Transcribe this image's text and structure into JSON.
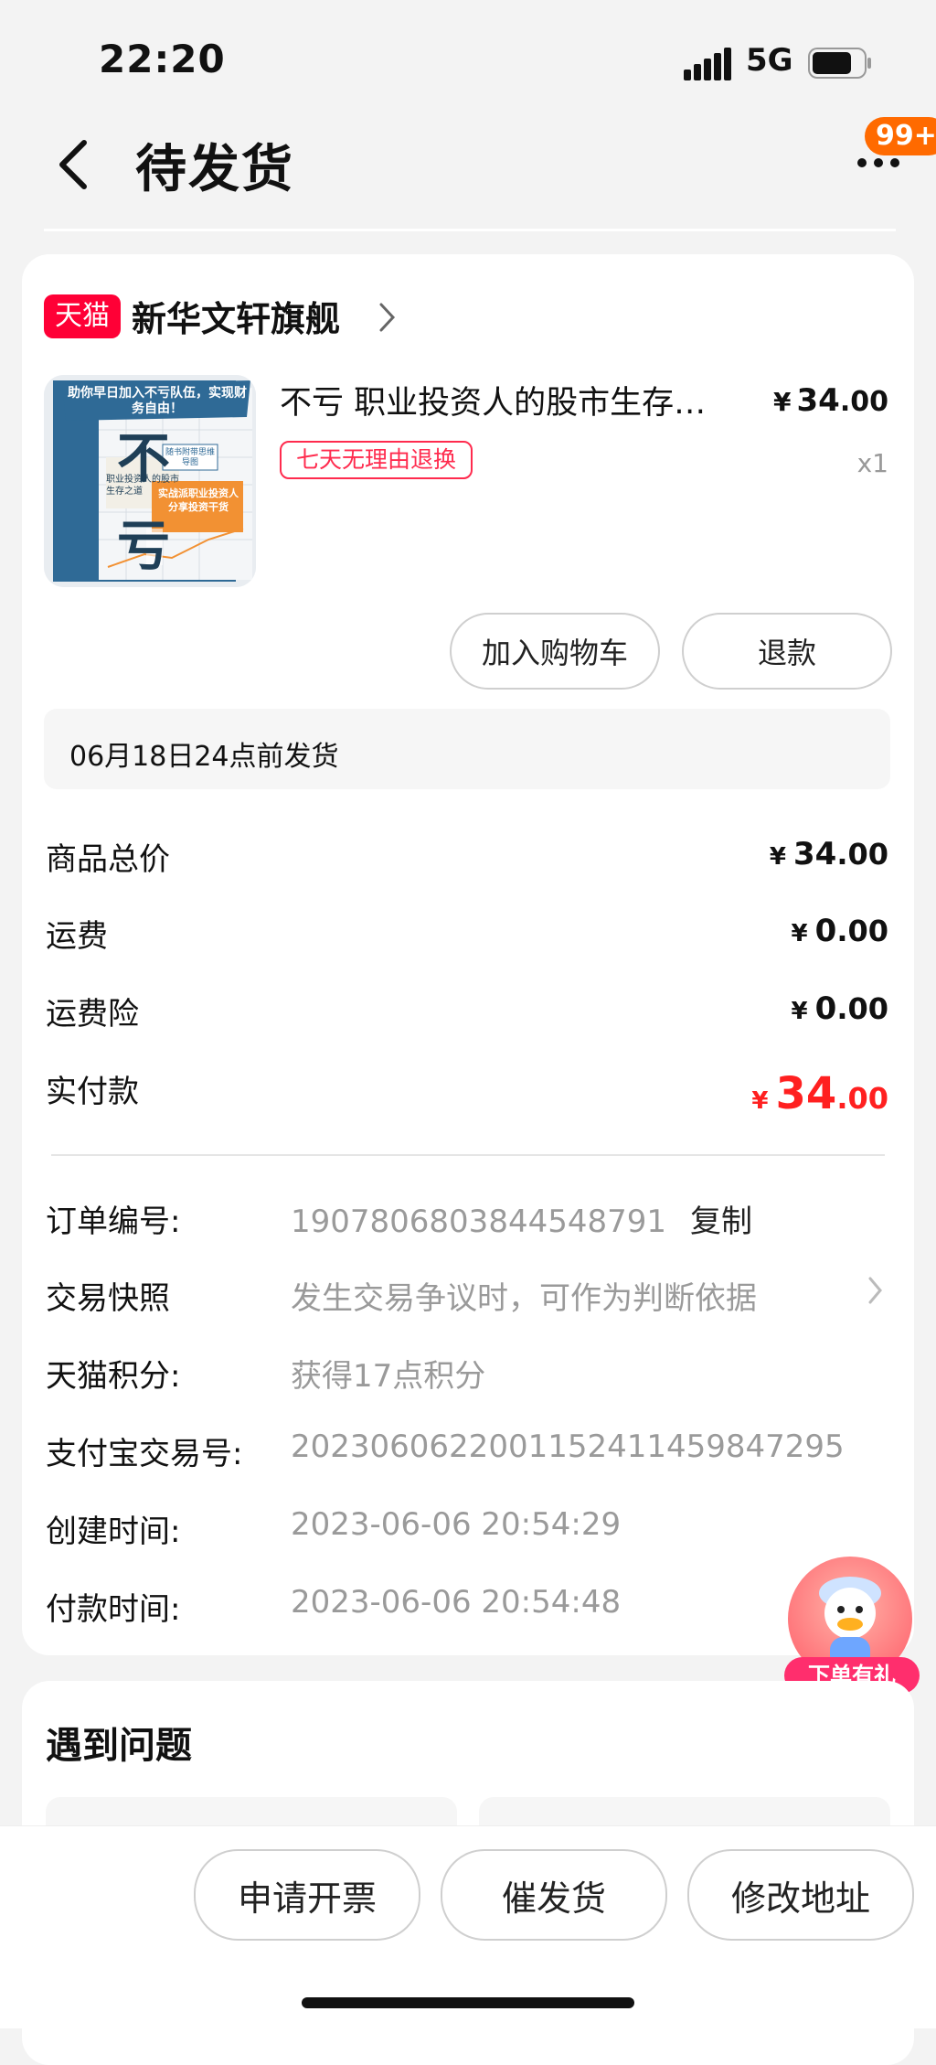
{
  "status_bar": {
    "time": "22:20",
    "network": "5G"
  },
  "header": {
    "title": "待发货",
    "notification_badge": "99+"
  },
  "order": {
    "platform_tag": "天猫",
    "shop_name": "新华文轩旗舰",
    "product": {
      "title": "不亏 职业投资人的股市生存…",
      "price_currency": "¥",
      "price_int": "34",
      "price_dec": ".00",
      "quantity": "x1",
      "tag": "七天无理由退换",
      "cover": {
        "banner": "助你早日加入不亏队伍，实现财务自由！",
        "big_char_1": "不",
        "big_char_2": "亏",
        "subtitle": "职业投资人的股市生存之道",
        "sticker": "随书附带思维导图",
        "side_text": "实战派职业投资人分享投资干货"
      }
    },
    "buttons": {
      "add_to_cart": "加入购物车",
      "refund": "退款"
    },
    "shipping_note": "06月18日24点前发货",
    "summary": [
      {
        "label": "商品总价",
        "currency": "¥",
        "int": "34",
        "dec": ".00"
      },
      {
        "label": "运费",
        "currency": "¥",
        "int": "0",
        "dec": ".00"
      },
      {
        "label": "运费险",
        "currency": "¥",
        "int": "0",
        "dec": ".00"
      },
      {
        "label": "实付款",
        "currency": "¥",
        "int": "34",
        "dec": ".00"
      }
    ],
    "info": [
      {
        "label": "订单编号:",
        "value": "1907806803844548791",
        "action": "复制"
      },
      {
        "label": "交易快照",
        "value": "发生交易争议时，可作为判断依据"
      },
      {
        "label": "天猫积分:",
        "value": "获得17点积分"
      },
      {
        "label": "支付宝交易号:",
        "value": "2023060622001152411459847295"
      },
      {
        "label": "创建时间:",
        "value": "2023-06-06 20:54:29"
      },
      {
        "label": "付款时间:",
        "value": "2023-06-06 20:54:48"
      }
    ]
  },
  "floating_promo": {
    "label": "下单有礼"
  },
  "problems": {
    "title": "遇到问题"
  },
  "bottom_actions": {
    "invoice": "申请开票",
    "urge_ship": "催发货",
    "change_address": "修改地址"
  },
  "colors": {
    "accent_red": "#ff2020",
    "tmall_red": "#ff0036",
    "badge_orange": "#ff6a00"
  }
}
